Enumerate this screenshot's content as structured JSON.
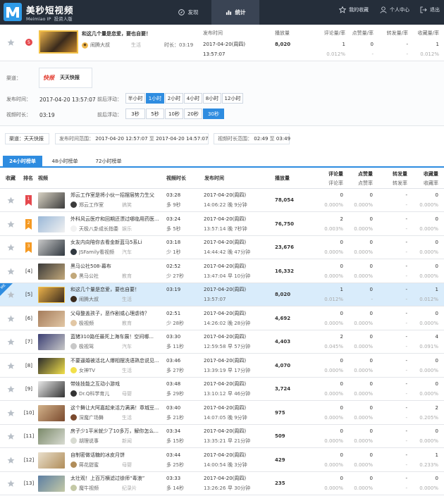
{
  "header": {
    "brand_title": "美秒短视频",
    "brand_sub": "Meimiao IP",
    "brand_edition": "投资人版",
    "nav": {
      "discover": "发现",
      "stats": "统计"
    },
    "right": {
      "favorites": "我的收藏",
      "profile": "个人中心",
      "logout": "退出"
    }
  },
  "top_card": {
    "rank": "5",
    "title": "和这几个量是恋爱，要也自要！",
    "channel": "闹腾大叔",
    "category": "生活",
    "duration_label": "时长：03:19",
    "publish_label": "发布时间",
    "publish_date": "2017-04-20(周四)",
    "publish_time": "13:57:07",
    "plays_label": "播放量",
    "plays": "8,020",
    "comments_label": "评论量/率",
    "comments": "1",
    "comments_rate": "0.012%",
    "likes_label": "点赞量/率",
    "likes": "0",
    "likes_rate": "-",
    "shares_label": "转发量/率",
    "shares": "-",
    "shares_rate": "-",
    "favs_label": "收藏量/率",
    "favs": "1",
    "favs_rate": "0.012%"
  },
  "filters": {
    "channel_label": "渠道：",
    "channel_logo": "快报",
    "channel_name": "天天快报",
    "time_label": "发布时间：",
    "time_value": "2017-04-20 13:57:07",
    "time_float_label": "前后浮动：",
    "time_options": [
      "半小时",
      "1小时",
      "2小时",
      "4小时",
      "8小时",
      "12小时"
    ],
    "duration_label": "视频时长：",
    "duration_value": "03:19",
    "dur_float_label": "前后浮动：",
    "dur_options": [
      "3秒",
      "5秒",
      "10秒",
      "20秒",
      "30秒"
    ]
  },
  "summary": {
    "channel": "渠道：天天快报",
    "range_label": "发布时间范围：",
    "range_from": "2017-04-20 12:57:07",
    "to": "至",
    "range_to": "2017-04-20 14:57:07",
    "dur_label": "视频时长范围：",
    "dur_from": "02:49",
    "dur_to": "03:49"
  },
  "tabs": [
    "24小时榜单",
    "48小时榜单",
    "72小时榜单"
  ],
  "columns": {
    "fav": "收藏",
    "rank": "排名",
    "video": "视频",
    "duration": "视频时长",
    "publish": "发布时间",
    "plays": "播放量",
    "comments": "评论量",
    "comments_rate": "评论率",
    "likes": "点赞量",
    "likes_rate": "点赞率",
    "shares": "转发量",
    "shares_rate": "转发率",
    "favs": "收藏量",
    "favs_rate": "收藏率"
  },
  "me_badge": "ME",
  "rows": [
    {
      "rank": "1",
      "title": "郑云工作室是将小伙一招摆层势力生父",
      "channel": "郑云工作室",
      "cat": "搞笑",
      "dur": "03:28",
      "diff": "多 9秒",
      "date": "2017-04-20(周四)",
      "time": "14:06:22",
      "late": "晚 9分钟",
      "plays": "78,054",
      "cm": "0",
      "cmr": "0.000%",
      "lk": "0",
      "lkr": "0.000%",
      "sh": "-",
      "shr": "-",
      "fv": "0",
      "fvr": "0.000%"
    },
    {
      "rank": "2",
      "title": "外科风云医疗和回期还漂过哪临用药医...",
      "channel": "天极八卦成长指委",
      "cat": "娱乐",
      "dur": "03:24",
      "diff": "多 5秒",
      "date": "2017-04-20(周四)",
      "time": "13:57:14",
      "late": "晚 7秒钟",
      "plays": "76,750",
      "cm": "2",
      "cmr": "0.003%",
      "lk": "0",
      "lkr": "0.000%",
      "sh": "-",
      "shr": "-",
      "fv": "0",
      "fvr": "0.000%"
    },
    {
      "rank": "3",
      "title": "女友内向陪你去看金新蓝马5系Li",
      "channel": "JSFamily看视频",
      "cat": "汽车",
      "dur": "03:18",
      "diff": "少 1秒",
      "date": "2017-04-20(周四)",
      "time": "14:44:42",
      "late": "晚 47分钟",
      "plays": "23,676",
      "cm": "0",
      "cmr": "0.000%",
      "lk": "0",
      "lkr": "0.000%",
      "sh": "-",
      "shr": "-",
      "fv": "0",
      "fvr": "0.000%"
    },
    {
      "rank": "[4]",
      "title": "黑马公社508-幕布",
      "channel": "黑马公社",
      "cat": "教育",
      "dur": "02:52",
      "diff": "少 27秒",
      "date": "2017-04-20(周四)",
      "time": "13:47:04",
      "late": "早 10分钟",
      "plays": "16,332",
      "cm": "0",
      "cmr": "0.000%",
      "lk": "0",
      "lkr": "0.000%",
      "sh": "-",
      "shr": "-",
      "fv": "0",
      "fvr": "0.000%"
    },
    {
      "rank": "[5]",
      "title": "和这几个量是恋爱，要也自要！",
      "channel": "闹腾大叔",
      "cat": "生活",
      "dur": "03:19",
      "diff": "",
      "date": "2017-04-20(周四)",
      "time": "13:57:07",
      "late": "",
      "plays": "8,020",
      "cm": "1",
      "cmr": "0.012%",
      "lk": "0",
      "lkr": "-",
      "sh": "-",
      "shr": "-",
      "fv": "1",
      "fvr": "0.012%"
    },
    {
      "rank": "[6]",
      "title": "父母整盖孩子，恶作剧或心理虐待？",
      "channel": "极视频",
      "cat": "教育",
      "dur": "02:51",
      "diff": "少 28秒",
      "date": "2017-04-20(周四)",
      "time": "14:26:02",
      "late": "晚 28分钟",
      "plays": "4,692",
      "cm": "0",
      "cmr": "0.000%",
      "lk": "0",
      "lkr": "0.000%",
      "sh": "-",
      "shr": "-",
      "fv": "0",
      "fvr": "0.000%"
    },
    {
      "rank": "[7]",
      "title": "蓝猪310路任最死上海车展！空间哪...",
      "channel": "极视驾",
      "cat": "汽车",
      "dur": "03:30",
      "diff": "多 11秒",
      "date": "2017-04-20(周四)",
      "time": "12:59:58",
      "late": "早 57分钟",
      "plays": "4,403",
      "cm": "2",
      "cmr": "0.045%",
      "lk": "0",
      "lkr": "0.000%",
      "sh": "-",
      "shr": "-",
      "fv": "4",
      "fvr": "0.091%"
    },
    {
      "rank": "[8]",
      "title": "不要逼婚被活北人爆相摆洗语熟恋说见...",
      "channel": "女神TV",
      "cat": "生活",
      "dur": "03:46",
      "diff": "多 27秒",
      "date": "2017-04-20(周四)",
      "time": "13:39:19",
      "late": "早 17分钟",
      "plays": "4,070",
      "cm": "0",
      "cmr": "0.000%",
      "lk": "0",
      "lkr": "0.000%",
      "sh": "-",
      "shr": "-",
      "fv": "0",
      "fvr": "0.000%"
    },
    {
      "rank": "[9]",
      "title": "带娃技能之互动小游戏",
      "channel": "Dr.Q科学育儿",
      "cat": "母婴",
      "dur": "03:48",
      "diff": "多 29秒",
      "date": "2017-04-20(周四)",
      "time": "13:10:12",
      "late": "早 46分钟",
      "plays": "3,724",
      "cm": "0",
      "cmr": "0.000%",
      "lk": "0",
      "lkr": "0.000%",
      "sh": "-",
      "shr": "-",
      "fv": "0",
      "fvr": "0.000%"
    },
    {
      "rank": "[10]",
      "title": "这个舞让大阿嘉起来活力满满！章城豆...",
      "channel": "深魔广场舞",
      "cat": "生活",
      "dur": "03:40",
      "diff": "多 21秒",
      "date": "2017-04-20(周四)",
      "time": "14:07:05",
      "late": "晚 9分钟",
      "plays": "975",
      "cm": "0",
      "cmr": "0.000%",
      "lk": "0",
      "lkr": "0.000%",
      "sh": "-",
      "shr": "-",
      "fv": "2",
      "fvr": "0.205%"
    },
    {
      "rank": "[11]",
      "title": "房子少1平米就少了10多万，解你怎么...",
      "channel": "胡理说事",
      "cat": "新闻",
      "dur": "03:34",
      "diff": "多 15秒",
      "date": "2017-04-20(周四)",
      "time": "13:35:21",
      "late": "早 21分钟",
      "plays": "509",
      "cm": "0",
      "cmr": "0.000%",
      "lk": "0",
      "lkr": "0.000%",
      "sh": "-",
      "shr": "-",
      "fv": "0",
      "fvr": "0.000%"
    },
    {
      "rank": "[12]",
      "title": "自制密做话糖的冰皮月饼",
      "channel": "蒋花甜蜜",
      "cat": "母婴",
      "dur": "03:44",
      "diff": "多 25秒",
      "date": "2017-04-20(周四)",
      "time": "14:00:54",
      "late": "晚 3分钟",
      "plays": "429",
      "cm": "0",
      "cmr": "0.000%",
      "lk": "0",
      "lkr": "0.000%",
      "sh": "-",
      "shr": "-",
      "fv": "1",
      "fvr": "0.233%"
    },
    {
      "rank": "[13]",
      "title": "太壮观！上百万横滤过徐师“毒浪”",
      "channel": "魔牛视频",
      "cat": "纪录片",
      "dur": "03:33",
      "diff": "多 14秒",
      "date": "2017-04-20(周四)",
      "time": "13:26:26",
      "late": "早 30分钟",
      "plays": "235",
      "cm": "0",
      "cmr": "0.000%",
      "lk": "0",
      "lkr": "0.000%",
      "sh": "-",
      "shr": "-",
      "fv": "0",
      "fvr": "0.000%"
    }
  ],
  "colors": {
    "header_bg": "#252e3a",
    "accent": "#2e8ce0",
    "rank_red": "#e5484d",
    "rank_orange": "#f59a23",
    "highlight_row": "#d9ecfb"
  }
}
